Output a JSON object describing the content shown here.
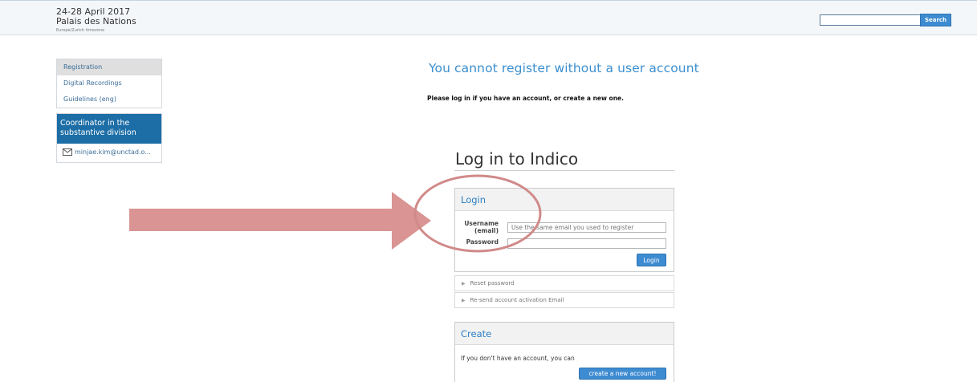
{
  "event": {
    "dates": "24-28 April 2017",
    "venue": "Palais des Nations",
    "timezone": "Europe/Zurich timezone"
  },
  "search": {
    "button_label": "Search",
    "value": ""
  },
  "sidebar": {
    "items": [
      {
        "label": "Registration",
        "active": true
      },
      {
        "label": "Digital Recordings",
        "active": false
      },
      {
        "label": "Guidelines (eng)",
        "active": false
      }
    ],
    "contact": {
      "heading": "Coordinator in the substantive division",
      "email": "minjae.kim@unctad.o..."
    }
  },
  "main": {
    "title": "You cannot register without a user account",
    "message": "Please log in if you have an account, or create a new one."
  },
  "login": {
    "page_title": "Log in to Indico",
    "panel_title": "Login",
    "username_label_1": "Username",
    "username_label_2": "(email)",
    "username_placeholder": "Use the same email you used to register",
    "password_label": "Password",
    "button_label": "Login",
    "links": [
      "Reset password",
      "Re-send account activation Email"
    ]
  },
  "create": {
    "panel_title": "Create",
    "text": "If you don't have an account, you can",
    "button_label": "create a new account!"
  },
  "colors": {
    "accent_blue": "#3d8bd1",
    "sidebar_dark_blue": "#1d6ea6",
    "annotation_red": "#d99493"
  },
  "icons": [
    "envelope-icon",
    "triangle-right-icon"
  ]
}
